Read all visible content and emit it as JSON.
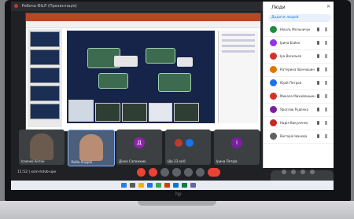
{
  "window": {
    "title": "Робоча Ф&Л (Презентація)"
  },
  "participants_panel": {
    "title": "Люди",
    "add_label": "Додати людей",
    "people": [
      {
        "name": "Ніколь Мельничук",
        "color": "#1e8e3e"
      },
      {
        "name": "Ірина Бойко",
        "color": "#9334e6"
      },
      {
        "name": "Іра Васильєв",
        "color": "#d93025"
      },
      {
        "name": "Катерина Іванчишин",
        "color": "#e37400"
      },
      {
        "name": "Юрій Петров",
        "color": "#1a73e8"
      },
      {
        "name": "Микола Михайлишин",
        "color": "#d93025"
      },
      {
        "name": "Ярослав Руденко",
        "color": "#7b1fa2"
      },
      {
        "name": "Надія Вакуленко",
        "color": "#c62828"
      },
      {
        "name": "Вікторія Іванова",
        "color": "#5f6368"
      }
    ]
  },
  "tiles": [
    {
      "name": "Ісаєнко Антон",
      "type": "video"
    },
    {
      "name": "Лобів Андрій",
      "type": "video"
    },
    {
      "letter": "Д",
      "name": "Діана Сапожник",
      "color": "#8e24aa"
    },
    {
      "name": "Ще 23 осіб",
      "type": "others"
    },
    {
      "letter": "І",
      "name": "Ірина Петрів",
      "color": "#7b1fa2"
    }
  ],
  "meeting": {
    "info": "11:52 | xsm-hdvb-ujw"
  },
  "brand": "hp"
}
